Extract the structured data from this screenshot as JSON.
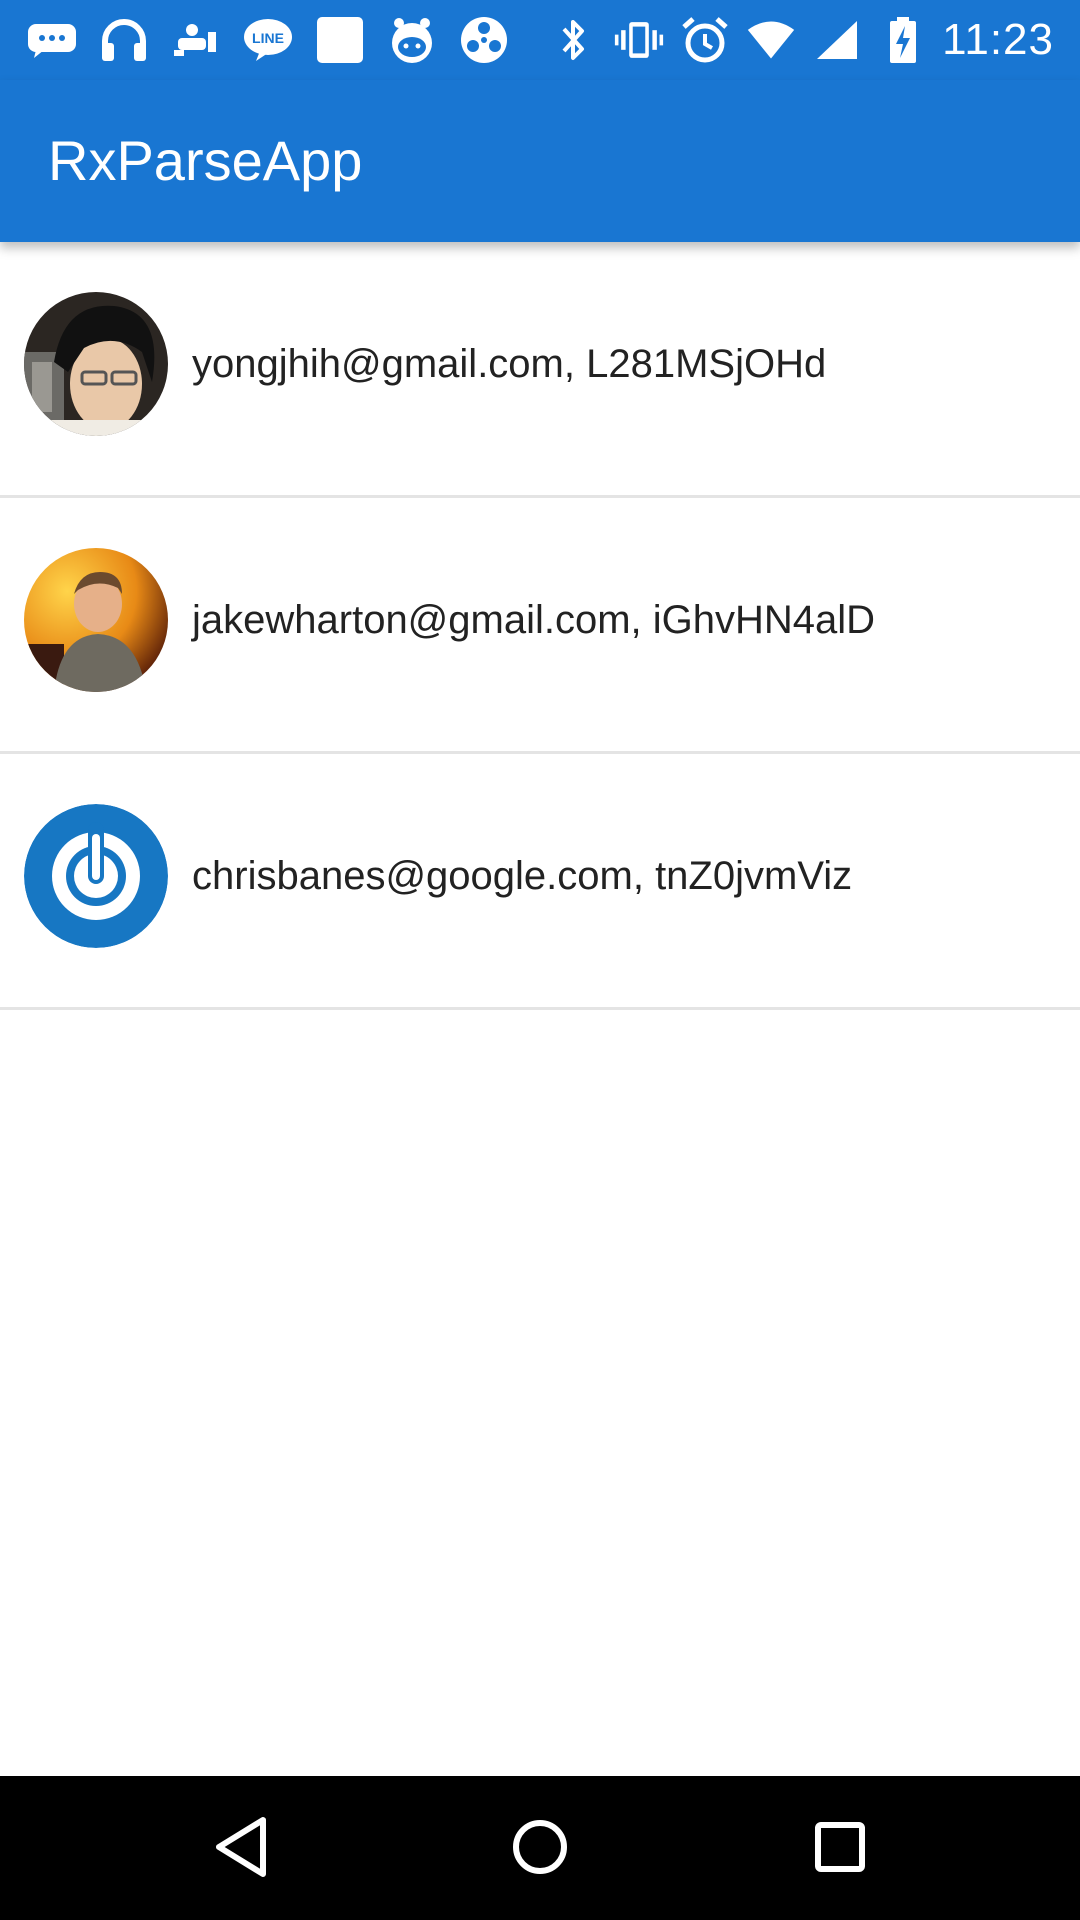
{
  "status_bar": {
    "time": "11:23",
    "left_icons": [
      "chat-bubble-icon",
      "headphones-icon",
      "game-icon",
      "line-icon",
      "blank-square-icon",
      "mascot-icon",
      "film-reel-icon"
    ],
    "right_icons": [
      "bluetooth-icon",
      "vibrate-icon",
      "alarm-icon",
      "wifi-icon",
      "signal-icon",
      "battery-charging-icon"
    ],
    "line_label": "LINE"
  },
  "app_bar": {
    "title": "RxParseApp",
    "color": "#1976d2"
  },
  "users": [
    {
      "label": "yongjhih@gmail.com, L281MSjOHd",
      "avatar": "avatar-photo-1"
    },
    {
      "label": "jakewharton@gmail.com, iGhvHN4alD",
      "avatar": "avatar-photo-2"
    },
    {
      "label": "chrisbanes@google.com, tnZ0jvmViz",
      "avatar": "avatar-power-logo"
    }
  ],
  "nav_bar": {
    "buttons": [
      "back-icon",
      "home-icon",
      "recents-icon"
    ]
  }
}
